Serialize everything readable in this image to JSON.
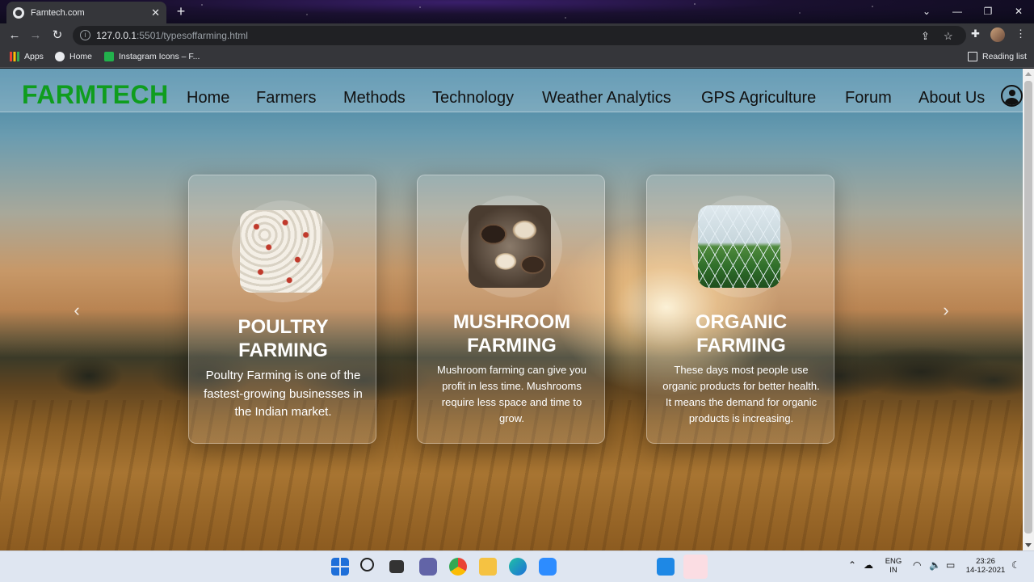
{
  "browser": {
    "tab_title": "Famtech.com",
    "url_host": "127.0.0.1",
    "url_rest": ":5501/typesoffarming.html",
    "bookmarks": [
      "Apps",
      "Home",
      "Instagram Icons – F..."
    ],
    "reading_list": "Reading list"
  },
  "site": {
    "brand": "FARMTECH",
    "brand_color": "#0f9d1e",
    "nav": [
      "Home",
      "Farmers",
      "Methods",
      "Technology",
      "Weather Analytics",
      "GPS Agriculture",
      "Forum",
      "About Us"
    ]
  },
  "cards": [
    {
      "title_line1": "POULTRY",
      "title_line2": "FARMING",
      "text": "Poultry Farming is one of the fastest-growing businesses in the Indian market.",
      "image": "poultry-farm-photo"
    },
    {
      "title_line1": "MUSHROOM",
      "title_line2": "FARMING",
      "text": "Mushroom farming can give you profit in less time. Mushrooms require less space and time to grow.",
      "image": "mushroom-bowl-photo"
    },
    {
      "title_line1": "ORGANIC",
      "title_line2": "FARMING",
      "text": "These days most people use organic products for better health. It means the demand for organic products is increasing.",
      "image": "greenhouse-photo"
    }
  ],
  "taskbar": {
    "lang1": "ENG",
    "lang2": "IN",
    "time": "23:26",
    "date": "14-12-2021"
  }
}
